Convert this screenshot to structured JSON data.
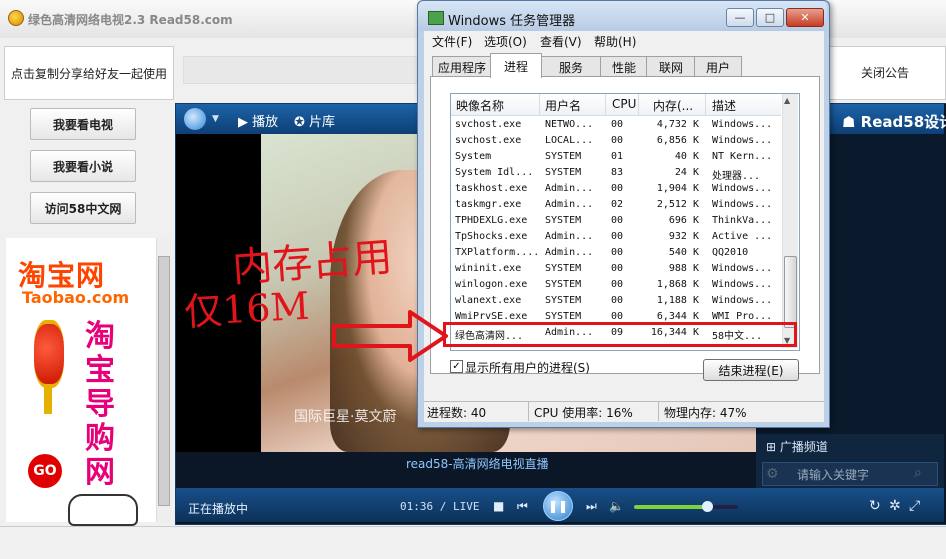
{
  "app": {
    "title": "绿色高清网络电视2.3   Read58.com",
    "share_label": "点击复制分享给好友一起使用",
    "close_notice": "关闭公告",
    "sidebar_buttons": [
      "我要看电视",
      "我要看小说",
      "访问58中文网"
    ],
    "ad": {
      "title": "淘宝网",
      "url": "Taobao.com",
      "vertical_text": [
        "淘",
        "宝",
        "导",
        "购",
        "网"
      ],
      "badge": "GO"
    }
  },
  "player": {
    "play_tab": "播放",
    "library_tab": "片库",
    "brand": "Read58设计",
    "watermark": "国际巨星·莫文蔚",
    "caption": "read58-高清网络电视直播",
    "status": "正在播放中",
    "time": "01:36 / LIVE",
    "volume": 0.7,
    "broadcast_channel": "广播频道",
    "search_placeholder": "请输入关键字"
  },
  "task_manager": {
    "title": "Windows 任务管理器",
    "menu": [
      "文件(F)",
      "选项(O)",
      "查看(V)",
      "帮助(H)"
    ],
    "tabs": [
      "应用程序",
      "进程",
      "服务",
      "性能",
      "联网",
      "用户"
    ],
    "active_tab": "进程",
    "columns": [
      "映像名称",
      "用户名",
      "CPU",
      "内存(...",
      "描述"
    ],
    "rows": [
      [
        "svchost.exe",
        "NETWO...",
        "00",
        "4,732 K",
        "Windows..."
      ],
      [
        "svchost.exe",
        "LOCAL...",
        "00",
        "6,856 K",
        "Windows..."
      ],
      [
        "System",
        "SYSTEM",
        "01",
        "40 K",
        "NT Kern..."
      ],
      [
        "System Idl...",
        "SYSTEM",
        "83",
        "24 K",
        "处理器..."
      ],
      [
        "taskhost.exe",
        "Admin...",
        "00",
        "1,904 K",
        "Windows..."
      ],
      [
        "taskmgr.exe",
        "Admin...",
        "02",
        "2,512 K",
        "Windows..."
      ],
      [
        "TPHDEXLG.exe",
        "SYSTEM",
        "00",
        "696 K",
        "ThinkVa..."
      ],
      [
        "TpShocks.exe",
        "Admin...",
        "00",
        "932 K",
        "Active ..."
      ],
      [
        "TXPlatform....",
        "Admin...",
        "00",
        "540 K",
        "QQ2010"
      ],
      [
        "wininit.exe",
        "SYSTEM",
        "00",
        "988 K",
        "Windows..."
      ],
      [
        "winlogon.exe",
        "SYSTEM",
        "00",
        "1,868 K",
        "Windows..."
      ],
      [
        "wlanext.exe",
        "SYSTEM",
        "00",
        "1,188 K",
        "Windows..."
      ],
      [
        "WmiPrvSE.exe",
        "SYSTEM",
        "00",
        "6,344 K",
        "WMI Pro..."
      ],
      [
        "绿色高清网...",
        "Admin...",
        "09",
        "16,344 K",
        "58中文..."
      ]
    ],
    "show_all_users": "显示所有用户的进程(S)",
    "end_process": "结束进程(E)",
    "status": {
      "processes": "进程数: 40",
      "cpu": "CPU 使用率: 16%",
      "memory": "物理内存: 47%"
    }
  },
  "annotation": {
    "note": "内存占用",
    "value": "仅16M"
  }
}
